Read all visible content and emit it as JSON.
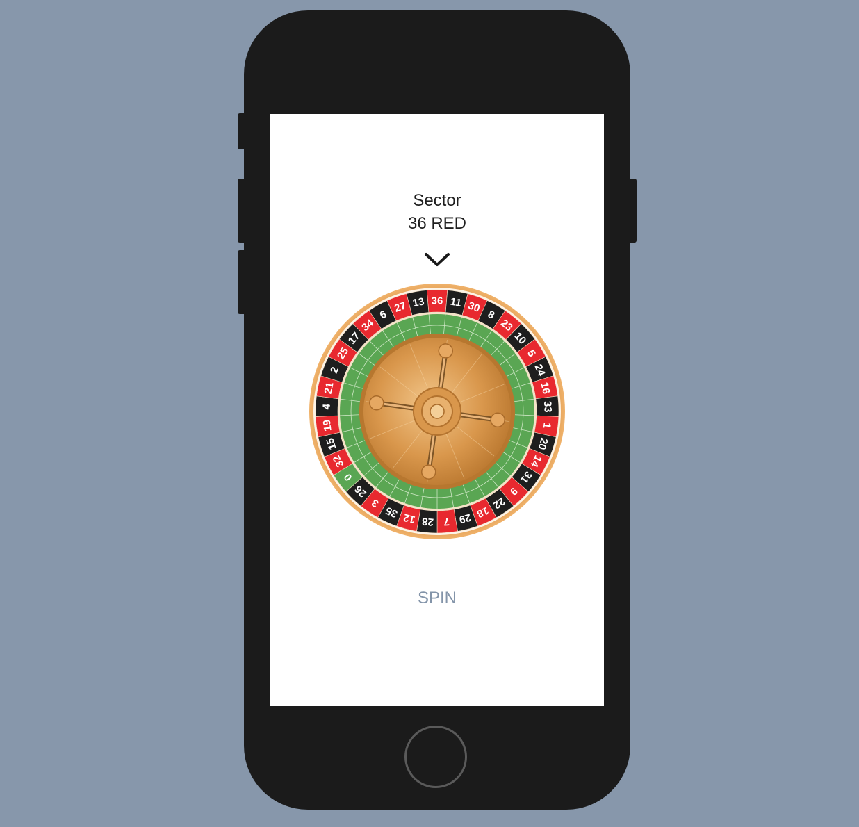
{
  "header": {
    "title": "Sector",
    "result": "36 RED"
  },
  "spin": {
    "label": "SPIN"
  },
  "icons": {
    "pointer": "chevron-down-icon"
  },
  "colors": {
    "background": "#8797ab",
    "phone_body": "#1b1b1b",
    "red": "#e8292f",
    "black": "#1e1e1e",
    "green": "#5aa653",
    "gold": "#d89a4e",
    "spin_text": "#8394a9"
  },
  "wheel": {
    "sequence": [
      36,
      11,
      30,
      8,
      23,
      10,
      5,
      24,
      16,
      33,
      1,
      20,
      14,
      31,
      9,
      22,
      18,
      29,
      7,
      28,
      12,
      35,
      3,
      26,
      0,
      32,
      15,
      19,
      4,
      21,
      2,
      25,
      17,
      34,
      6,
      27,
      13
    ],
    "red_numbers": [
      1,
      3,
      5,
      7,
      9,
      12,
      14,
      16,
      18,
      19,
      21,
      23,
      25,
      27,
      30,
      32,
      34,
      36
    ]
  }
}
